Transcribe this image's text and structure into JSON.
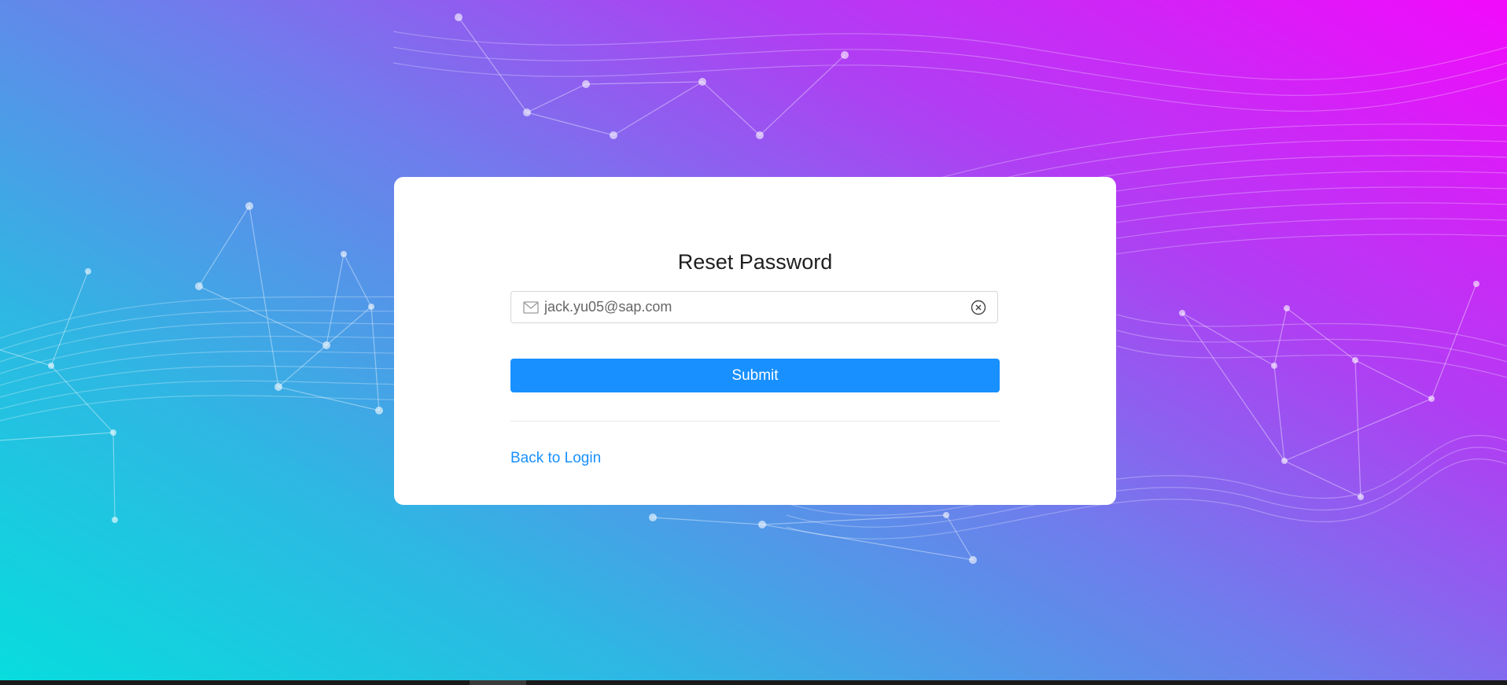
{
  "page": {
    "title": "Reset Password"
  },
  "form": {
    "email_value": "jack.yu05@sap.com",
    "submit_label": "Submit",
    "back_link_label": "Back to Login"
  },
  "icons": {
    "email": "mail-icon",
    "clear": "clear-circle-icon"
  },
  "colors": {
    "primary": "#1890ff",
    "gradient_start": "#07dddd",
    "gradient_end": "#f20afb",
    "card_background": "#ffffff"
  }
}
